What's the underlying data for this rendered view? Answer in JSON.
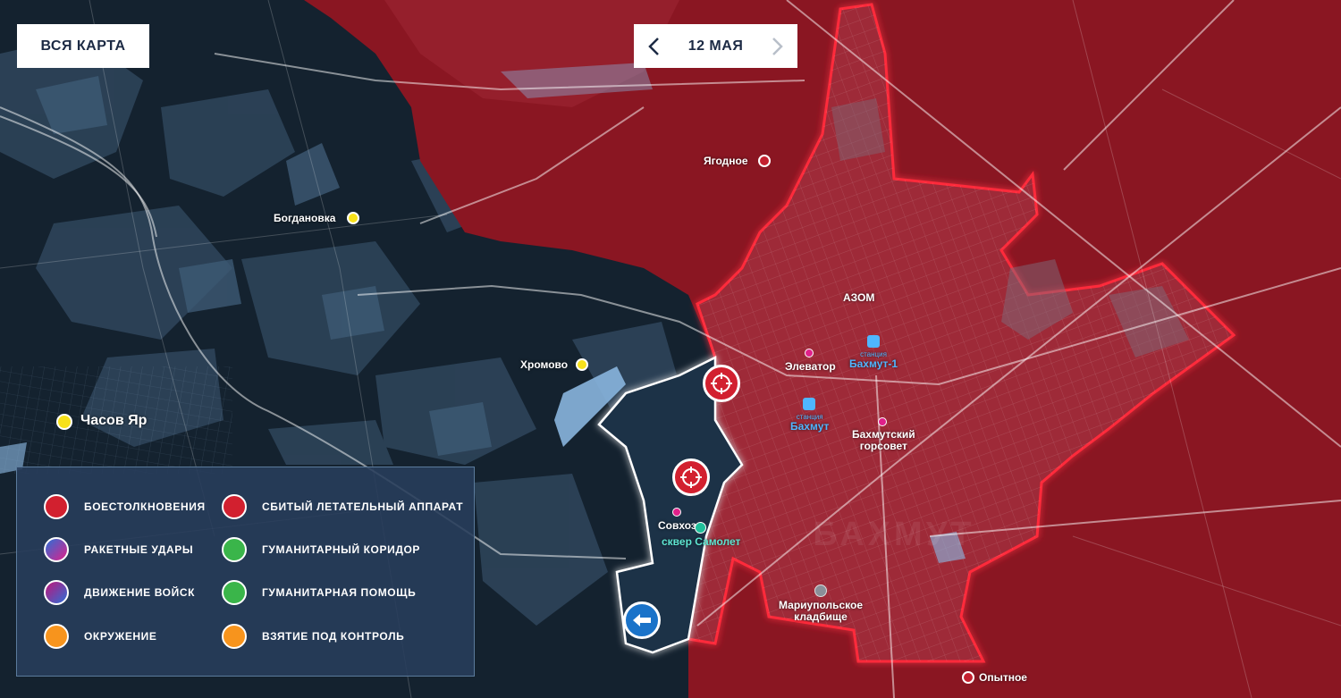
{
  "top_controls": {
    "all_map_label": "ВСЯ КАРТА",
    "date_label": "12 МАЯ"
  },
  "map_labels": {
    "yagodnoe": "Ягодное",
    "bogdanovka": "Богдановка",
    "khromovo": "Хромово",
    "chasov_yar": "Часов Яр",
    "azom": "АЗОМ",
    "elevator": "Элеватор",
    "station_bakhmut1_word": "станция",
    "station_bakhmut1_name": "Бахмут-1",
    "station_bakhmut_word": "станция",
    "station_bakhmut_name": "Бахмут",
    "gorsovet_line1": "Бахмутский",
    "gorsovet_line2": "горсовет",
    "sovkhoz": "Совхоз",
    "skver": "сквер Самолет",
    "cemetery_line1": "Мариупольское",
    "cemetery_line2": "кладбище",
    "opytnoe": "Опытное",
    "city_watermark": "БАХМУТ"
  },
  "legend": {
    "items": [
      {
        "label": "БОЕСТОЛКНОВЕНИЯ",
        "icon": "clash-icon",
        "color": "#d2202f"
      },
      {
        "label": "СБИТЫЙ ЛЕТАТЕЛЬНЫЙ АППАРАТ",
        "icon": "downed-aircraft-icon",
        "color": "#d2202f"
      },
      {
        "label": "РАКЕТНЫЕ УДАРЫ",
        "icon": "missile-strike-icon",
        "color": "#7a3ab8"
      },
      {
        "label": "ГУМАНИТАРНЫЙ КОРИДОР",
        "icon": "humanitarian-corridor-icon",
        "color": "#3ab54a"
      },
      {
        "label": "ДВИЖЕНИЕ ВОЙСК",
        "icon": "troop-movement-icon",
        "color": "#c0157a"
      },
      {
        "label": "ГУМАНИТАРНАЯ ПОМОЩЬ",
        "icon": "humanitarian-aid-icon",
        "color": "#3ab54a"
      },
      {
        "label": "ОКРУЖЕНИЕ",
        "icon": "encirclement-icon",
        "color": "#f7941d"
      },
      {
        "label": "ВЗЯТИЕ ПОД КОНТРОЛЬ",
        "icon": "capture-control-icon",
        "color": "#f7941d"
      }
    ]
  },
  "colors": {
    "controlled_zone": "#8e1722",
    "city_fill": "#9c2431",
    "city_border": "#ff2a3a",
    "dark_land": "#162638",
    "station_blue": "#4fb6ff",
    "settlement_yellow": "#f7e11a"
  }
}
